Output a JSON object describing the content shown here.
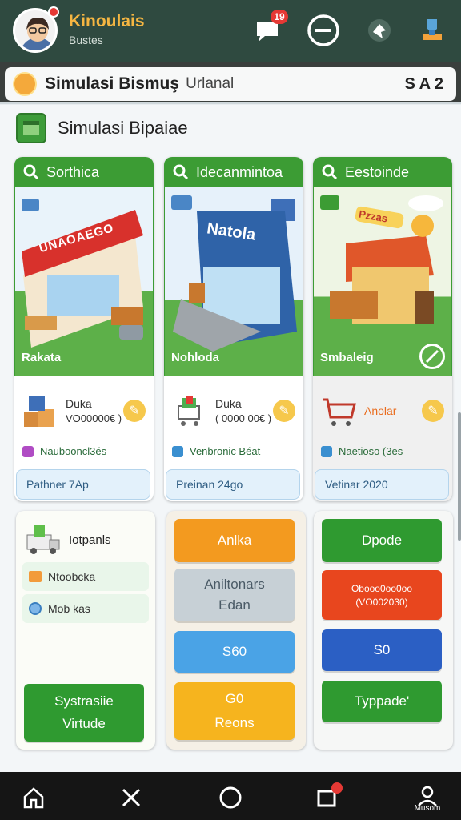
{
  "header": {
    "app_title": "Kinoulais",
    "app_subtitle": "Bustes",
    "notif_count": "19",
    "colors": {
      "bar": "#2f4a40",
      "title": "#f5b642"
    }
  },
  "subheader": {
    "title": "Simulasi Bismuş",
    "title_suffix": "Urlanal",
    "right_text": "S A 2"
  },
  "section": {
    "title": "Simulasi Bipaiae"
  },
  "cards": [
    {
      "header": "Sorthica",
      "scene_label": "Rakata",
      "badge_sign": "UNAOAEGO",
      "info_title": "Duka",
      "info_value": "VO00000€ )",
      "row_label": "Naubooncl3és",
      "pill": "Pathner 7Ap"
    },
    {
      "header": "Idecanmintoa",
      "scene_label": "Nohloda",
      "badge_sign": "Natola",
      "info_title": "Duka",
      "info_value": "( 0000 00€ )",
      "row_label": "Venbronic Béat",
      "pill": "Preinan 24go"
    },
    {
      "header": "Eestoinde",
      "scene_label": "Smbaleig",
      "badge_sign": "Pzzas",
      "info_title": "Anolar",
      "info_value": "",
      "row_label": "Naetioso (3es",
      "pill": "Vetinar 2020"
    }
  ],
  "panels": {
    "left": {
      "title": "Iotpanls",
      "items": [
        "Ntoobcka",
        "Mob kas"
      ],
      "button_line1": "Systrasiie",
      "button_line2": "Virtude"
    },
    "middle": {
      "btn_orange": "Anlka",
      "btn_grey_line1": "Aniltonars",
      "btn_grey_line2": "Edan",
      "btn_blue": "S60",
      "btn_yellow_line1": "G0",
      "btn_yellow_line2": "Reons"
    },
    "right": {
      "btn_green": "Dpode",
      "btn_red_line1": "Obooo0oo0oo",
      "btn_red_line2": "(VO002030)",
      "btn_blue": "S0",
      "btn_green2": "Typpade'"
    }
  },
  "bottom_nav": {
    "profile_label": "Musom"
  }
}
